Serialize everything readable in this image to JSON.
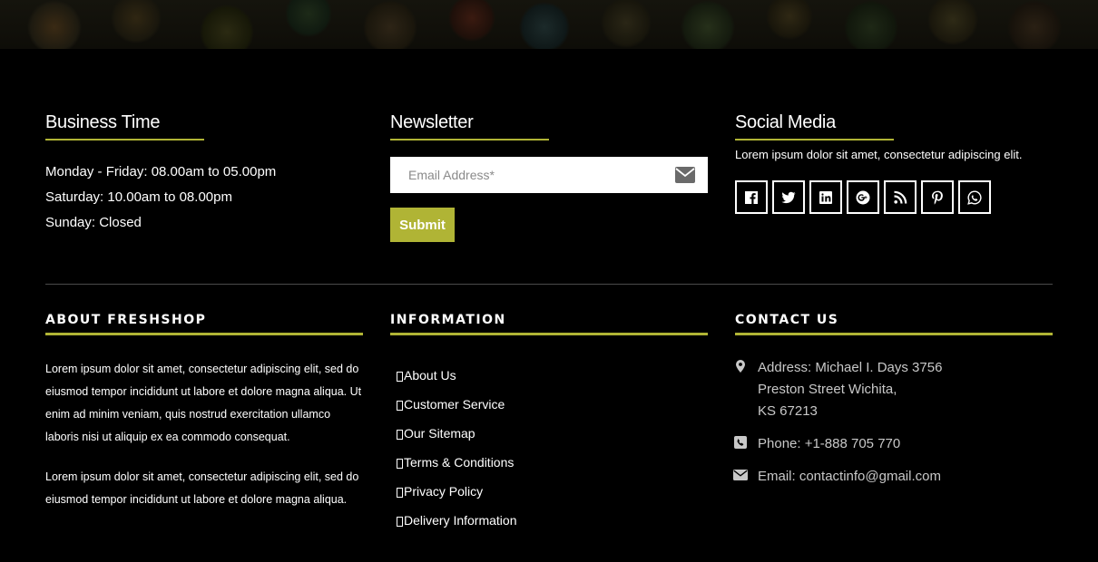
{
  "business_time": {
    "title": "Business Time",
    "lines": [
      "Monday - Friday: 08.00am to 05.00pm",
      "Saturday: 10.00am to 08.00pm",
      "Sunday: Closed"
    ]
  },
  "newsletter": {
    "title": "Newsletter",
    "email_placeholder": "Email Address*",
    "email_value": "",
    "submit_label": "Submit",
    "email_icon": "envelope-icon"
  },
  "social_media": {
    "title": "Social Media",
    "text": "Lorem ipsum dolor sit amet, consectetur adipiscing elit.",
    "icons": [
      "facebook-icon",
      "twitter-icon",
      "linkedin-icon",
      "google-plus-icon",
      "rss-icon",
      "pinterest-icon",
      "whatsapp-icon"
    ]
  },
  "about": {
    "title": "ABOUT FRESHSHOP",
    "paragraphs": [
      "Lorem ipsum dolor sit amet, consectetur adipiscing elit, sed do eiusmod tempor incididunt ut labore et dolore magna aliqua. Ut enim ad minim veniam, quis nostrud exercitation ullamco laboris nisi ut aliquip ex ea commodo consequat.",
      "Lorem ipsum dolor sit amet, consectetur adipiscing elit, sed do eiusmod tempor incididunt ut labore et dolore magna aliqua."
    ]
  },
  "information": {
    "title": "INFORMATION",
    "links": [
      "About Us",
      "Customer Service",
      "Our Sitemap",
      "Terms & Conditions",
      "Privacy Policy",
      "Delivery Information"
    ]
  },
  "contact": {
    "title": "CONTACT US",
    "address_lines": [
      "Address: Michael I. Days 3756",
      "Preston Street Wichita,",
      "KS 67213"
    ],
    "phone": "Phone: +1-888 705 770",
    "email": "Email: contactinfo@gmail.com"
  },
  "colors": {
    "accent": "#b0b435",
    "background": "#000000",
    "contact_text": "#c8c8c8"
  }
}
